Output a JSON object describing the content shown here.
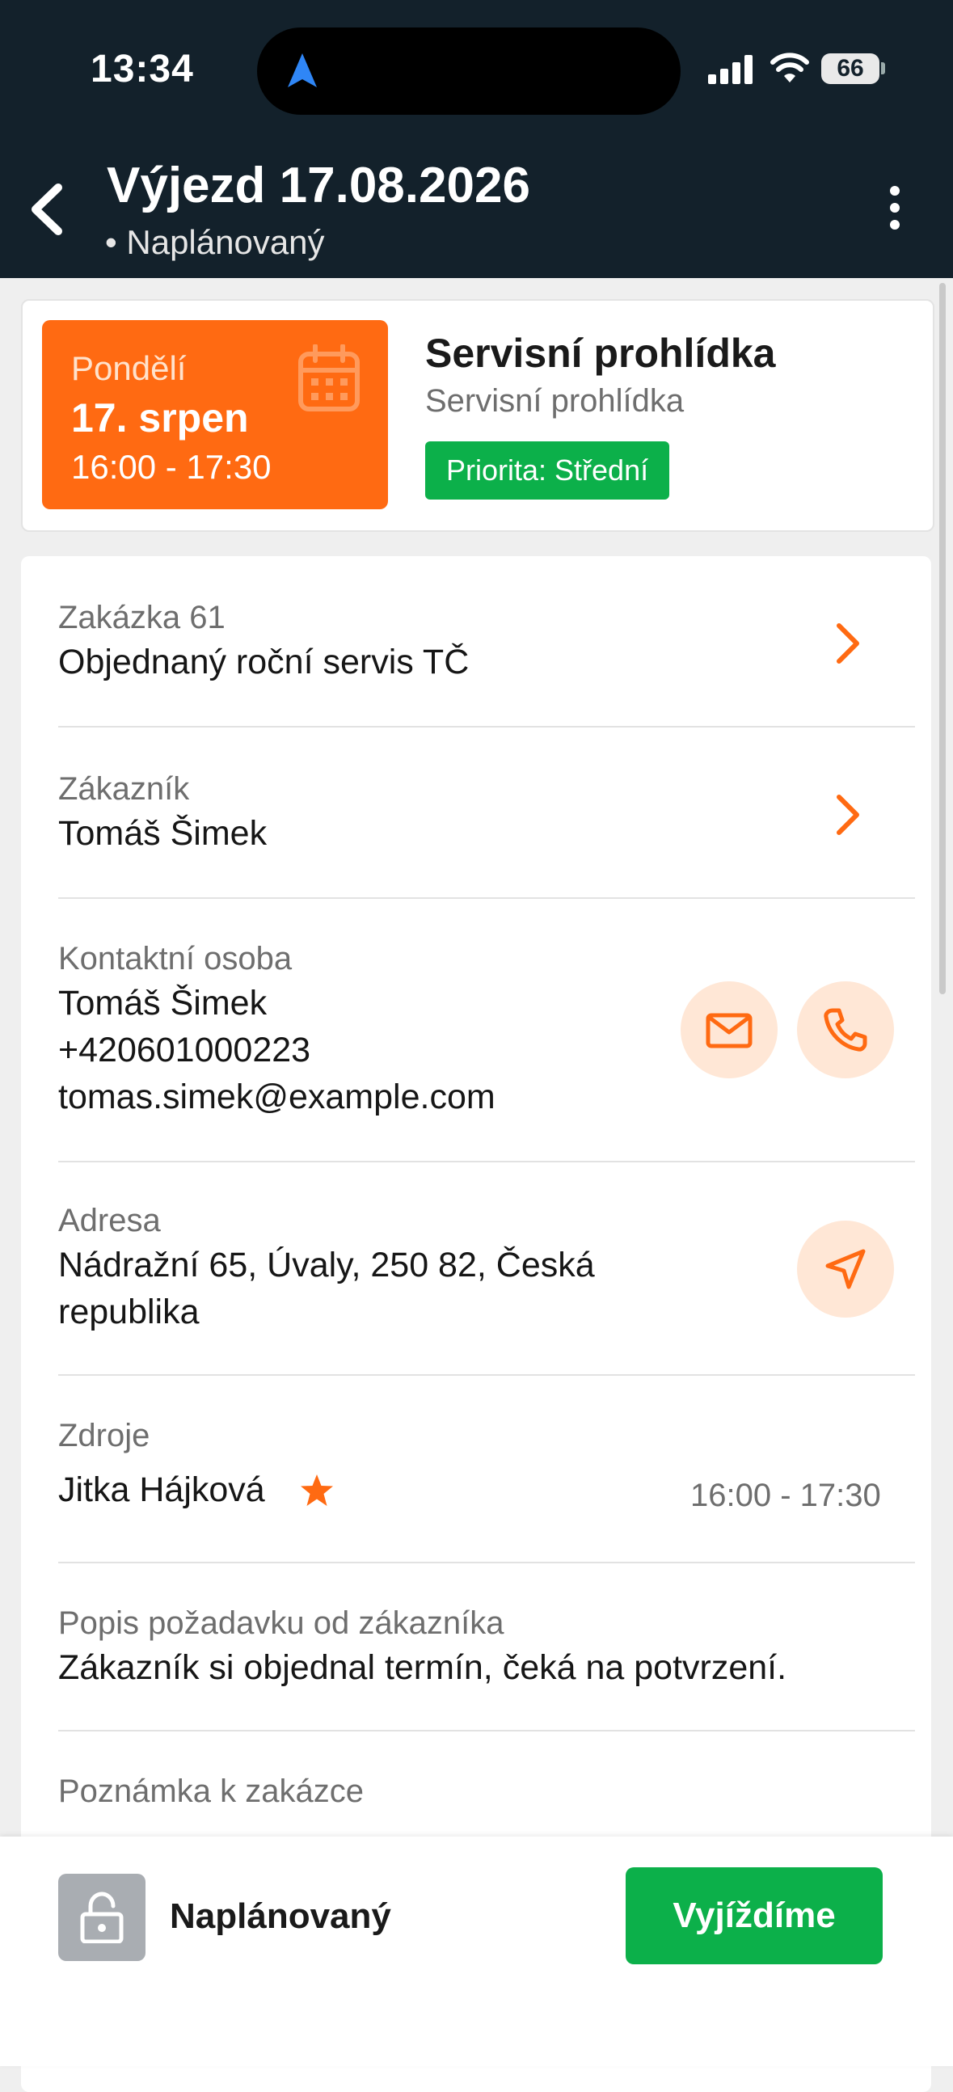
{
  "status_bar": {
    "time": "13:34",
    "battery": "66"
  },
  "header": {
    "title": "Výjezd 17.08.2026",
    "status": "• Naplánovaný"
  },
  "summary": {
    "day": "Pondělí",
    "date": "17. srpen",
    "time": "16:00 - 17:30",
    "service_title": "Servisní prohlídka",
    "service_subtitle": "Servisní prohlídka",
    "priority": "Priorita: Střední"
  },
  "order": {
    "label": "Zakázka 61",
    "value": "Objednaný roční servis TČ"
  },
  "customer": {
    "label": "Zákazník",
    "value": "Tomáš Šimek"
  },
  "contact": {
    "label": "Kontaktní osoba",
    "name": "Tomáš Šimek",
    "phone": "+420601000223",
    "email": "tomas.simek@example.com"
  },
  "address": {
    "label": "Adresa",
    "line1": "Nádražní 65, Úvaly, 250 82, Česká",
    "line2": "republika"
  },
  "resources": {
    "label": "Zdroje",
    "name": "Jitka Hájková",
    "time": "16:00 - 17:30"
  },
  "request": {
    "label": "Popis požadavku od zákazníka",
    "value": "Zákazník si objednal termín, čeká na potvrzení."
  },
  "note": {
    "label": "Poznámka k zakázce"
  },
  "bottom_bar": {
    "status": "Naplánovaný",
    "action": "Vyjíždíme"
  },
  "colors": {
    "accent": "#ff6a12",
    "success": "#0cb04a",
    "header_bg": "#13212b",
    "accent_soft": "#ffe7d6"
  }
}
